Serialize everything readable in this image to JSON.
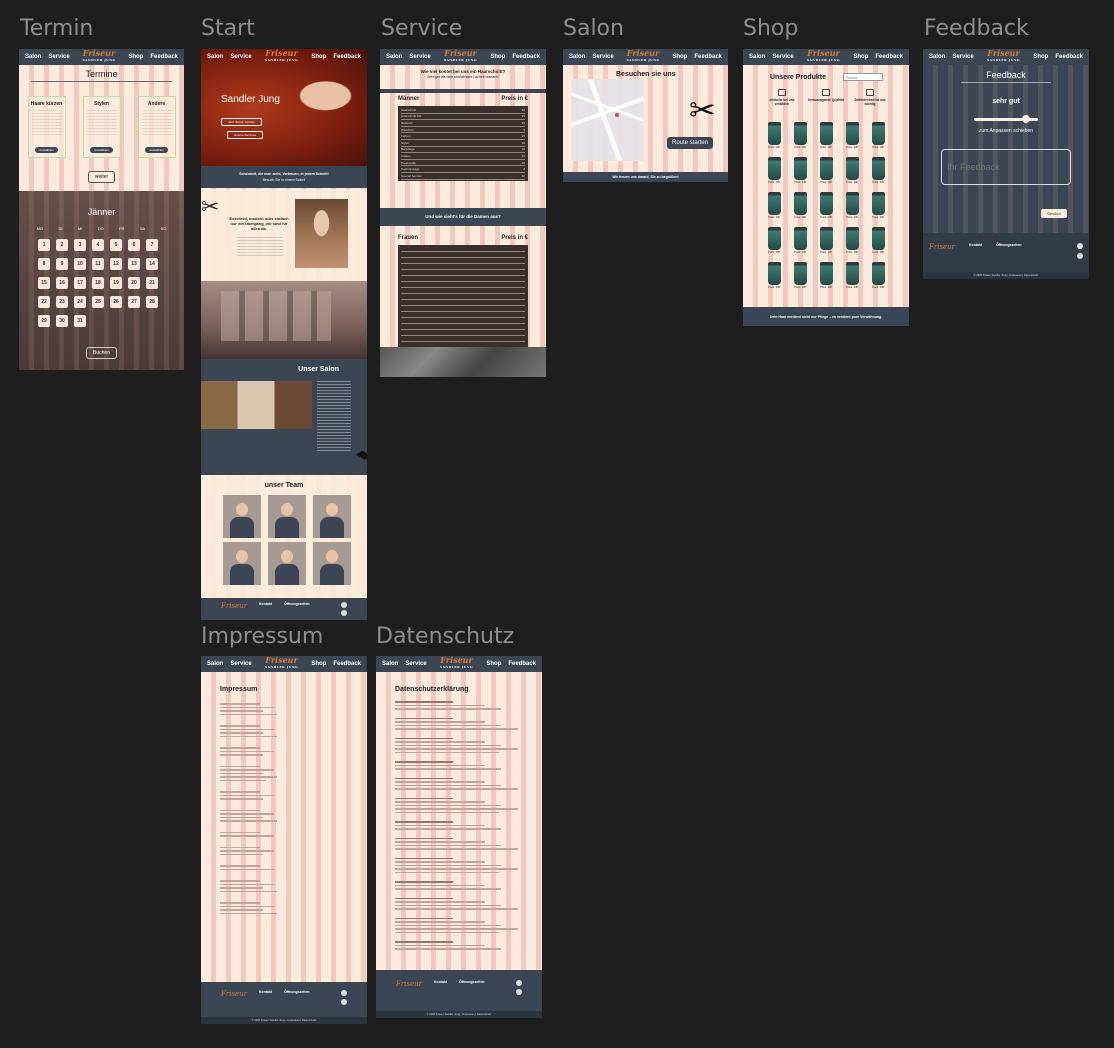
{
  "nav": {
    "salon": "Salon",
    "service": "Service",
    "shop": "Shop",
    "feedback": "Feedback",
    "logo": "Friseur",
    "logo_sub": "SANDLER JUNG"
  },
  "frame_titles": {
    "termin": "Termin",
    "start": "Start",
    "service": "Service",
    "salon": "Salon",
    "shop": "Shop",
    "feedback": "Feedback",
    "impressum": "Impressum",
    "datenschutz": "Datenschutz"
  },
  "termin": {
    "title": "Termine",
    "cards": [
      {
        "title": "Haare kürzen",
        "button": "Auswählen"
      },
      {
        "title": "Stylen",
        "button": "Auswählen"
      },
      {
        "title": "Andere",
        "button": "Auswählen"
      }
    ],
    "next": "weiter",
    "month": "Jänner",
    "weekdays": [
      "MO",
      "DI",
      "MI",
      "DO",
      "FR",
      "SA",
      "SO"
    ],
    "days": [
      "1",
      "2",
      "3",
      "4",
      "5",
      "6",
      "7",
      "8",
      "9",
      "10",
      "11",
      "12",
      "13",
      "14",
      "15",
      "16",
      "17",
      "18",
      "19",
      "20",
      "21",
      "22",
      "23",
      "24",
      "25",
      "26",
      "27",
      "28",
      "29",
      "30",
      "31"
    ],
    "book": "Buchen"
  },
  "start": {
    "hero_title": "Sandler Jung",
    "hero_btn1": "Jetzt Termin buchen",
    "hero_btn2": "Unsere Services",
    "band_text": "Schönheit, die man sieht, Vertrauen, in jedem Schnitt!",
    "band_sub": "Besuch Sie in einem Salon!",
    "intro_title": "Exzellent, modern oder einfach nur ein Übergang, wir sind für alles da.",
    "salon_title": "Unser Salon",
    "team_title": "unser Team"
  },
  "service": {
    "question": "Wie viel kostet bei uns ein Haarschnitt?",
    "sub": "Weniger als dein strahlendes Lächeln danach!",
    "men_title": "Männer",
    "women_title": "Frauen",
    "price_col": "Preis in €",
    "men_items": [
      {
        "name": "Haarschnitt",
        "price": "20"
      },
      {
        "name": "Haarschnitt Kid",
        "price": "15"
      },
      {
        "name": "Rasieren",
        "price": "10"
      },
      {
        "name": "Waschen",
        "price": "5"
      },
      {
        "name": "Färben",
        "price": "25"
      },
      {
        "name": "Stylen",
        "price": "10"
      },
      {
        "name": "Bartpflege",
        "price": "12"
      },
      {
        "name": "Glätten",
        "price": "20"
      },
      {
        "name": "Dauerwelle",
        "price": "40"
      },
      {
        "name": "Kopfmassage",
        "price": "8"
      },
      {
        "name": "Spezial Service",
        "price": "30"
      }
    ],
    "women_prompt": "Und wie sieht's für die Damen aus?",
    "women_rows": 18
  },
  "salon": {
    "title": "Besuchen sie uns",
    "route": "Route starten",
    "footer": "Wir freuen uns darauf, Sie zu begrüßen!"
  },
  "shop": {
    "title": "Unsere Produkte",
    "search": "Suche",
    "features": [
      "einfache bei uns erhältlich",
      "herausragende Qualität",
      "Zufriedenheit ist uns wichtig"
    ],
    "price": "Preis: 10€",
    "footer": "Dein Haar verdient nicht nur Pflege – es verdient pure Verwöhnung."
  },
  "feedback": {
    "title": "Feedback",
    "rating": "sehr gut",
    "hint": "zum Anpassen schieben",
    "placeholder": "Ihr Feedback",
    "submit": "Senden",
    "slider_level": 0.82
  },
  "footer": {
    "kontakt": "Kontakt",
    "oeffnung": "Öffnungszeiten",
    "copy": "© 2025 Friseur Sandler Jung | Impressum | Datenschutz"
  },
  "impressum": {
    "title": "Impressum"
  },
  "datenschutz": {
    "title": "Datenschutzerklärung"
  },
  "colors": {
    "navy": "#3b4553",
    "cream": "#fbecdc",
    "accent": "#d97b3c",
    "stripe": "#f3c9bf"
  }
}
